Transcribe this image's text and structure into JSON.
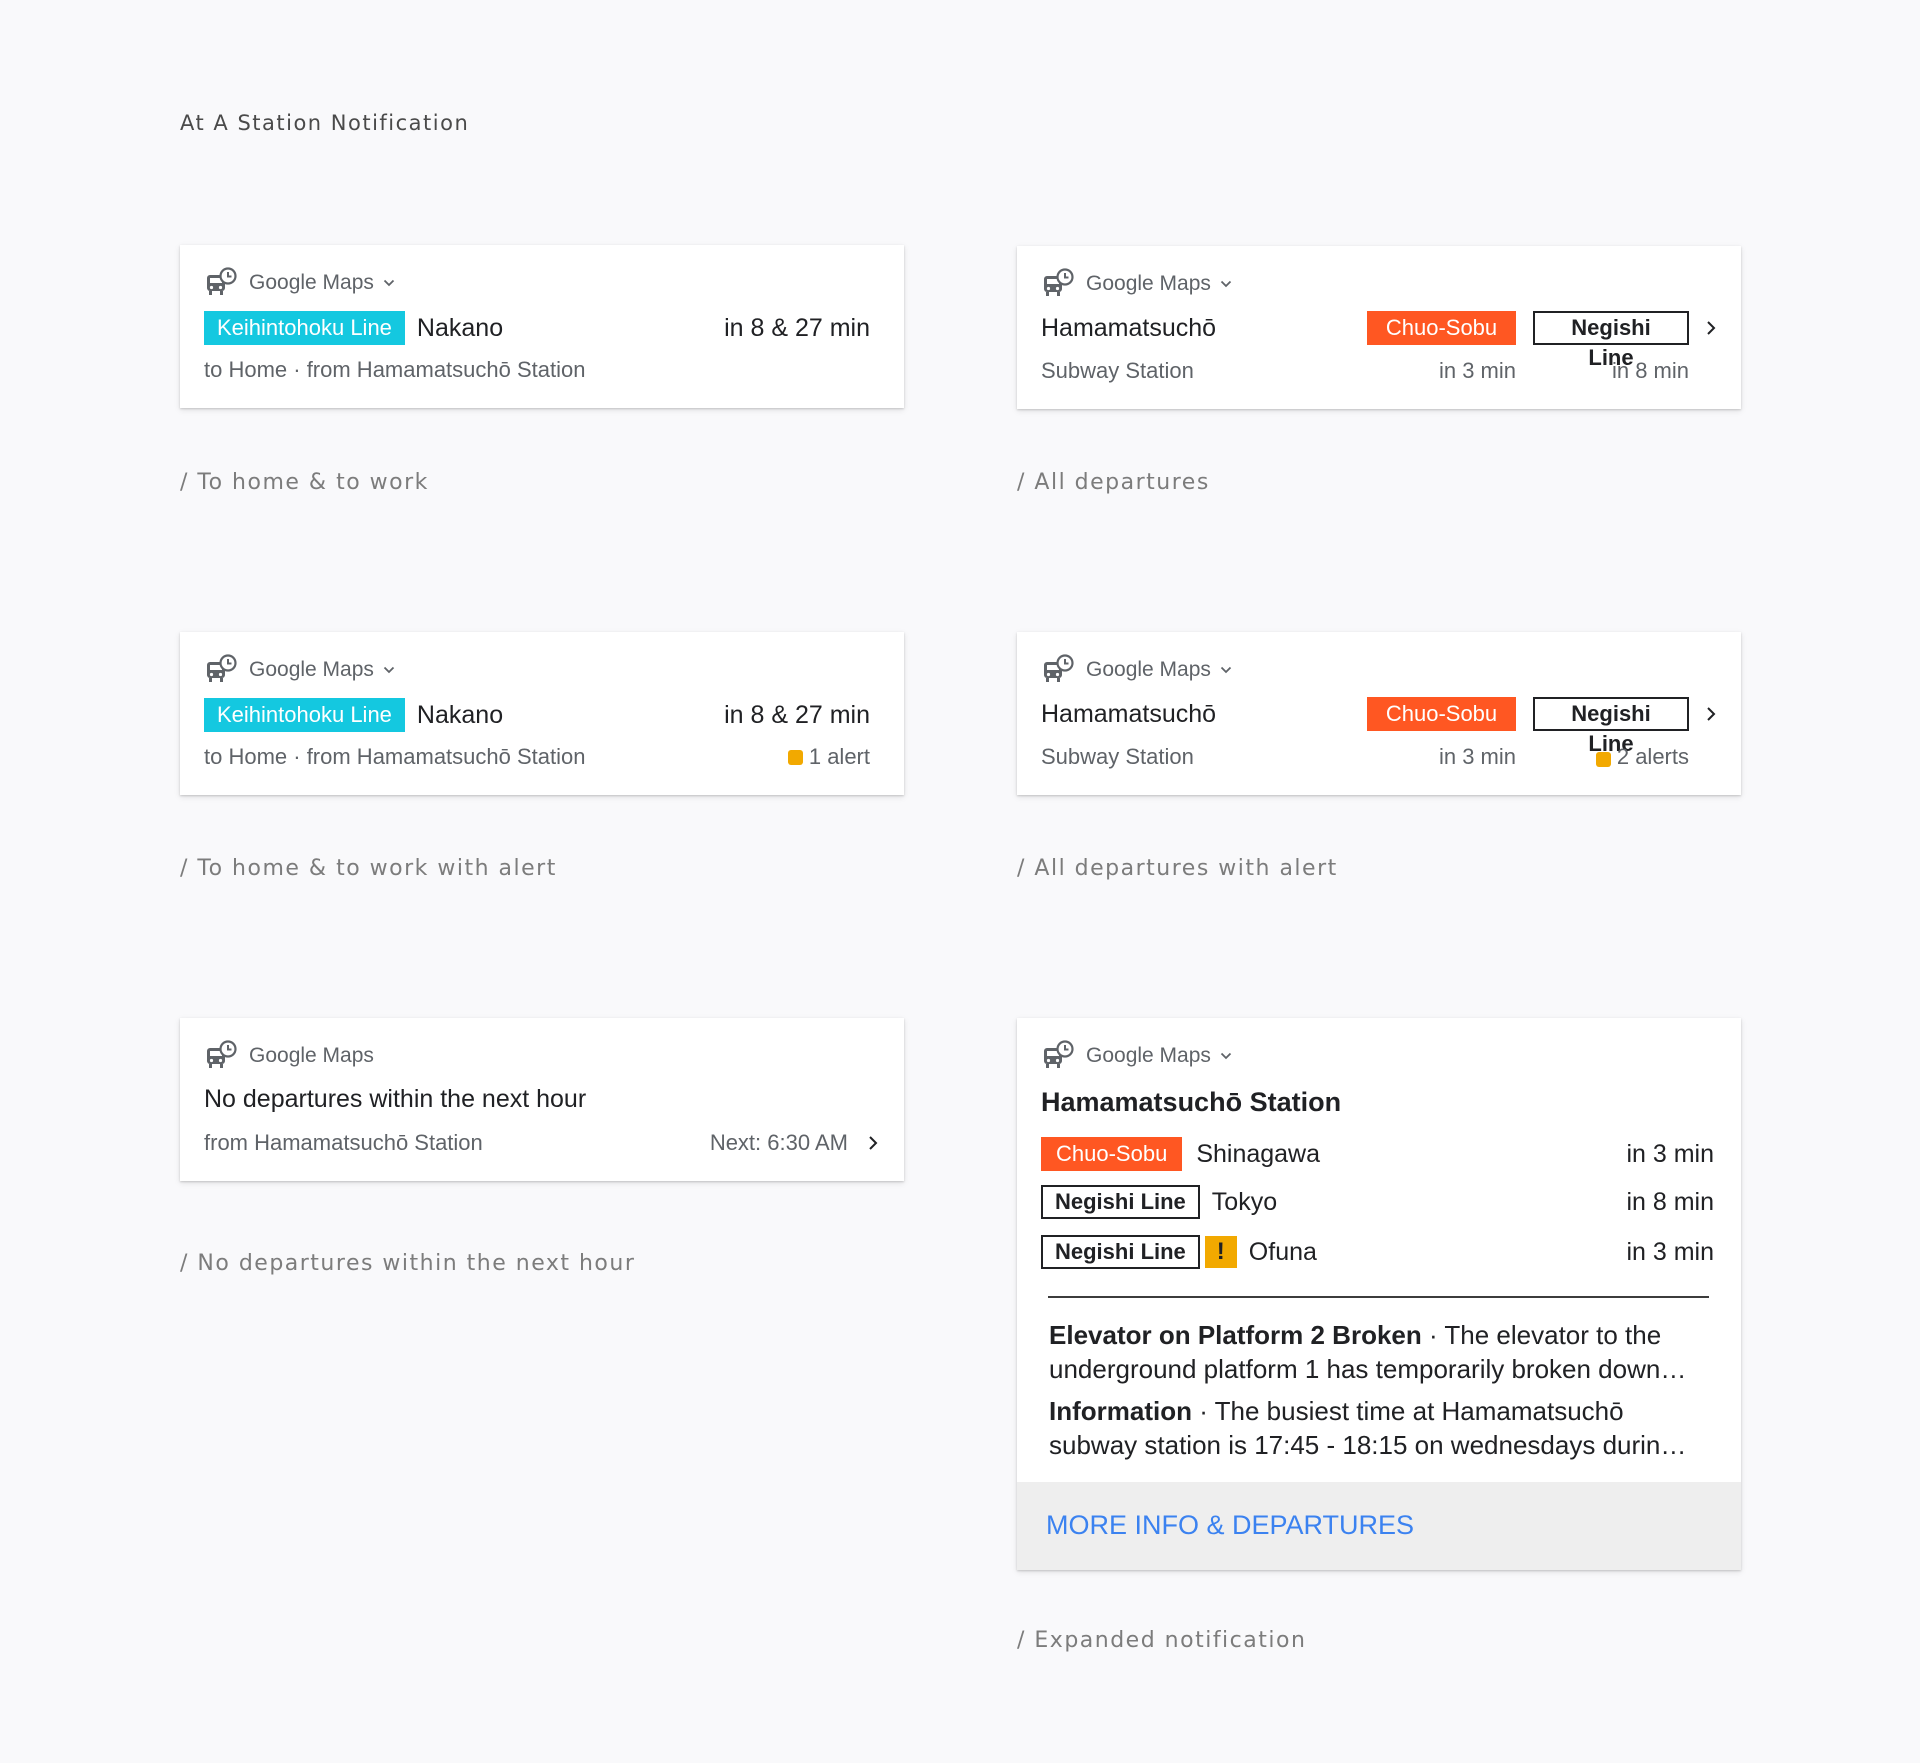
{
  "page": {
    "title": "At A Station Notification"
  },
  "app": {
    "name": "Google Maps"
  },
  "colors": {
    "cyan": "#14c8e0",
    "orange": "#ff5722",
    "alert": "#f2a900",
    "link": "#3b82f0"
  },
  "cards": {
    "home_work": {
      "line": "Keihintohoku Line",
      "destination": "Nakano",
      "times": "in 8 & 27 min",
      "subtitle": "to Home · from Hamamatsuchō Station",
      "caption": "/ To home & to work"
    },
    "all_departures": {
      "station": "Hamamatsuchō",
      "station_type": "Subway Station",
      "line1": "Chuo-Sobu",
      "line2": "Negishi Line",
      "time1": "in 3 min",
      "time2": "in 8 min",
      "caption": "/ All departures"
    },
    "home_work_alert": {
      "line": "Keihintohoku Line",
      "destination": "Nakano",
      "times": "in 8 & 27 min",
      "subtitle": "to Home · from Hamamatsuchō Station",
      "alert": "1 alert",
      "caption": "/ To home & to work with alert"
    },
    "all_departures_alert": {
      "station": "Hamamatsuchō",
      "station_type": "Subway Station",
      "line1": "Chuo-Sobu",
      "line2": "Negishi Line",
      "time1": "in 3 min",
      "alert": "2 alerts",
      "caption": "/ All departures with alert"
    },
    "no_departures": {
      "title": "No departures within the next hour",
      "subtitle": "from Hamamatsuchō Station",
      "next": "Next: 6:30 AM",
      "caption": "/ No departures within the next hour"
    },
    "expanded": {
      "station": "Hamamatsuchō Station",
      "departures": [
        {
          "line": "Chuo-Sobu",
          "destination": "Shinagawa",
          "time": "in 3 min"
        },
        {
          "line": "Negishi Line",
          "destination": "Tokyo",
          "time": "in 8 min"
        },
        {
          "line": "Negishi Line",
          "warning": "!",
          "destination": "Ofuna",
          "time": "in 3 min"
        }
      ],
      "alerts": [
        {
          "title": "Elevator on Platform 2 Broken",
          "body": " · The elevator to the underground platform 1 has temporarily broken down…"
        },
        {
          "title": "Information",
          "body": " · The busiest time at Hamamatsuchō subway station is 17:45 - 18:15 on wednesdays durin…"
        }
      ],
      "action": "MORE INFO & DEPARTURES",
      "caption": "/ Expanded notification"
    }
  }
}
